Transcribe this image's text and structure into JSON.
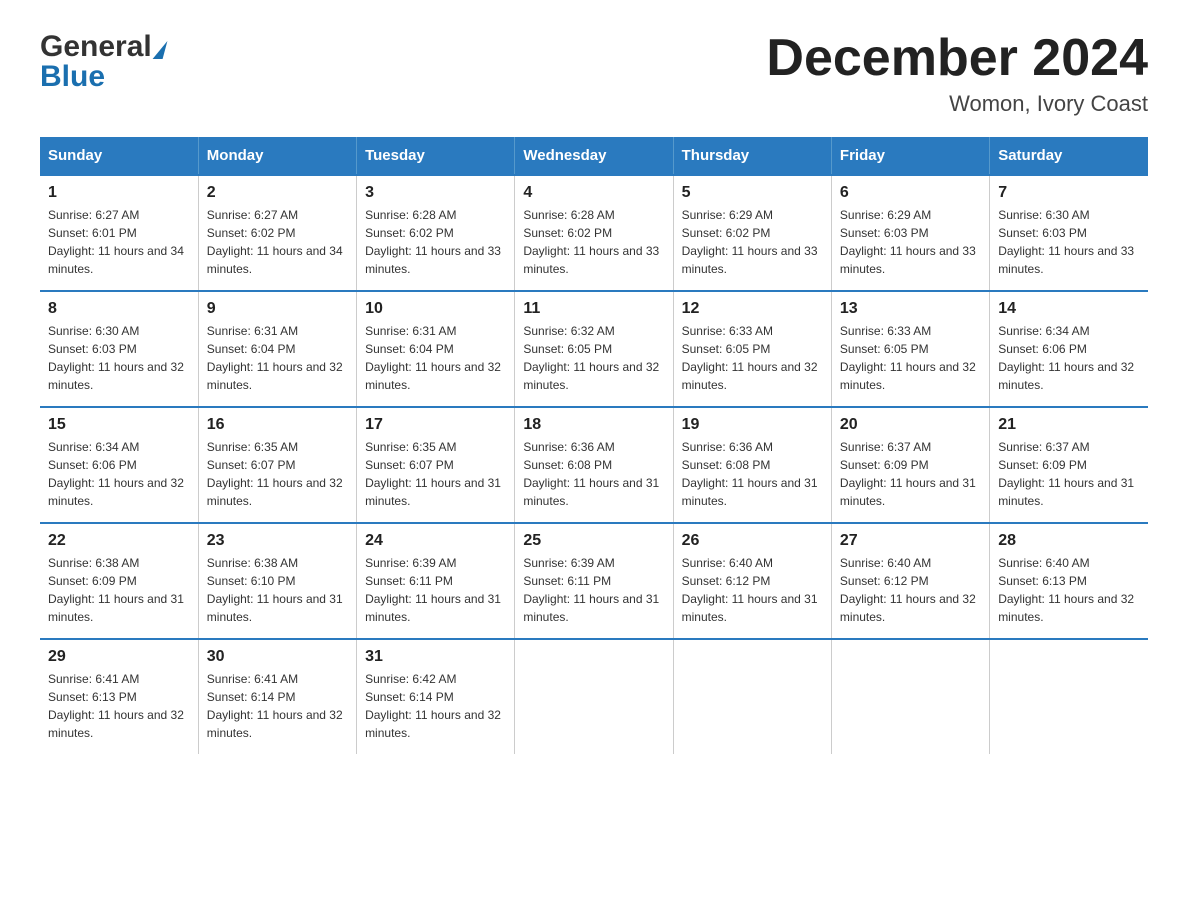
{
  "logo": {
    "text_general": "General",
    "text_blue": "Blue",
    "triangle": "▶"
  },
  "title": "December 2024",
  "location": "Womon, Ivory Coast",
  "days_of_week": [
    "Sunday",
    "Monday",
    "Tuesday",
    "Wednesday",
    "Thursday",
    "Friday",
    "Saturday"
  ],
  "weeks": [
    [
      {
        "day": "1",
        "sunrise": "6:27 AM",
        "sunset": "6:01 PM",
        "daylight": "11 hours and 34 minutes."
      },
      {
        "day": "2",
        "sunrise": "6:27 AM",
        "sunset": "6:02 PM",
        "daylight": "11 hours and 34 minutes."
      },
      {
        "day": "3",
        "sunrise": "6:28 AM",
        "sunset": "6:02 PM",
        "daylight": "11 hours and 33 minutes."
      },
      {
        "day": "4",
        "sunrise": "6:28 AM",
        "sunset": "6:02 PM",
        "daylight": "11 hours and 33 minutes."
      },
      {
        "day": "5",
        "sunrise": "6:29 AM",
        "sunset": "6:02 PM",
        "daylight": "11 hours and 33 minutes."
      },
      {
        "day": "6",
        "sunrise": "6:29 AM",
        "sunset": "6:03 PM",
        "daylight": "11 hours and 33 minutes."
      },
      {
        "day": "7",
        "sunrise": "6:30 AM",
        "sunset": "6:03 PM",
        "daylight": "11 hours and 33 minutes."
      }
    ],
    [
      {
        "day": "8",
        "sunrise": "6:30 AM",
        "sunset": "6:03 PM",
        "daylight": "11 hours and 32 minutes."
      },
      {
        "day": "9",
        "sunrise": "6:31 AM",
        "sunset": "6:04 PM",
        "daylight": "11 hours and 32 minutes."
      },
      {
        "day": "10",
        "sunrise": "6:31 AM",
        "sunset": "6:04 PM",
        "daylight": "11 hours and 32 minutes."
      },
      {
        "day": "11",
        "sunrise": "6:32 AM",
        "sunset": "6:05 PM",
        "daylight": "11 hours and 32 minutes."
      },
      {
        "day": "12",
        "sunrise": "6:33 AM",
        "sunset": "6:05 PM",
        "daylight": "11 hours and 32 minutes."
      },
      {
        "day": "13",
        "sunrise": "6:33 AM",
        "sunset": "6:05 PM",
        "daylight": "11 hours and 32 minutes."
      },
      {
        "day": "14",
        "sunrise": "6:34 AM",
        "sunset": "6:06 PM",
        "daylight": "11 hours and 32 minutes."
      }
    ],
    [
      {
        "day": "15",
        "sunrise": "6:34 AM",
        "sunset": "6:06 PM",
        "daylight": "11 hours and 32 minutes."
      },
      {
        "day": "16",
        "sunrise": "6:35 AM",
        "sunset": "6:07 PM",
        "daylight": "11 hours and 32 minutes."
      },
      {
        "day": "17",
        "sunrise": "6:35 AM",
        "sunset": "6:07 PM",
        "daylight": "11 hours and 31 minutes."
      },
      {
        "day": "18",
        "sunrise": "6:36 AM",
        "sunset": "6:08 PM",
        "daylight": "11 hours and 31 minutes."
      },
      {
        "day": "19",
        "sunrise": "6:36 AM",
        "sunset": "6:08 PM",
        "daylight": "11 hours and 31 minutes."
      },
      {
        "day": "20",
        "sunrise": "6:37 AM",
        "sunset": "6:09 PM",
        "daylight": "11 hours and 31 minutes."
      },
      {
        "day": "21",
        "sunrise": "6:37 AM",
        "sunset": "6:09 PM",
        "daylight": "11 hours and 31 minutes."
      }
    ],
    [
      {
        "day": "22",
        "sunrise": "6:38 AM",
        "sunset": "6:09 PM",
        "daylight": "11 hours and 31 minutes."
      },
      {
        "day": "23",
        "sunrise": "6:38 AM",
        "sunset": "6:10 PM",
        "daylight": "11 hours and 31 minutes."
      },
      {
        "day": "24",
        "sunrise": "6:39 AM",
        "sunset": "6:11 PM",
        "daylight": "11 hours and 31 minutes."
      },
      {
        "day": "25",
        "sunrise": "6:39 AM",
        "sunset": "6:11 PM",
        "daylight": "11 hours and 31 minutes."
      },
      {
        "day": "26",
        "sunrise": "6:40 AM",
        "sunset": "6:12 PM",
        "daylight": "11 hours and 31 minutes."
      },
      {
        "day": "27",
        "sunrise": "6:40 AM",
        "sunset": "6:12 PM",
        "daylight": "11 hours and 32 minutes."
      },
      {
        "day": "28",
        "sunrise": "6:40 AM",
        "sunset": "6:13 PM",
        "daylight": "11 hours and 32 minutes."
      }
    ],
    [
      {
        "day": "29",
        "sunrise": "6:41 AM",
        "sunset": "6:13 PM",
        "daylight": "11 hours and 32 minutes."
      },
      {
        "day": "30",
        "sunrise": "6:41 AM",
        "sunset": "6:14 PM",
        "daylight": "11 hours and 32 minutes."
      },
      {
        "day": "31",
        "sunrise": "6:42 AM",
        "sunset": "6:14 PM",
        "daylight": "11 hours and 32 minutes."
      },
      null,
      null,
      null,
      null
    ]
  ]
}
